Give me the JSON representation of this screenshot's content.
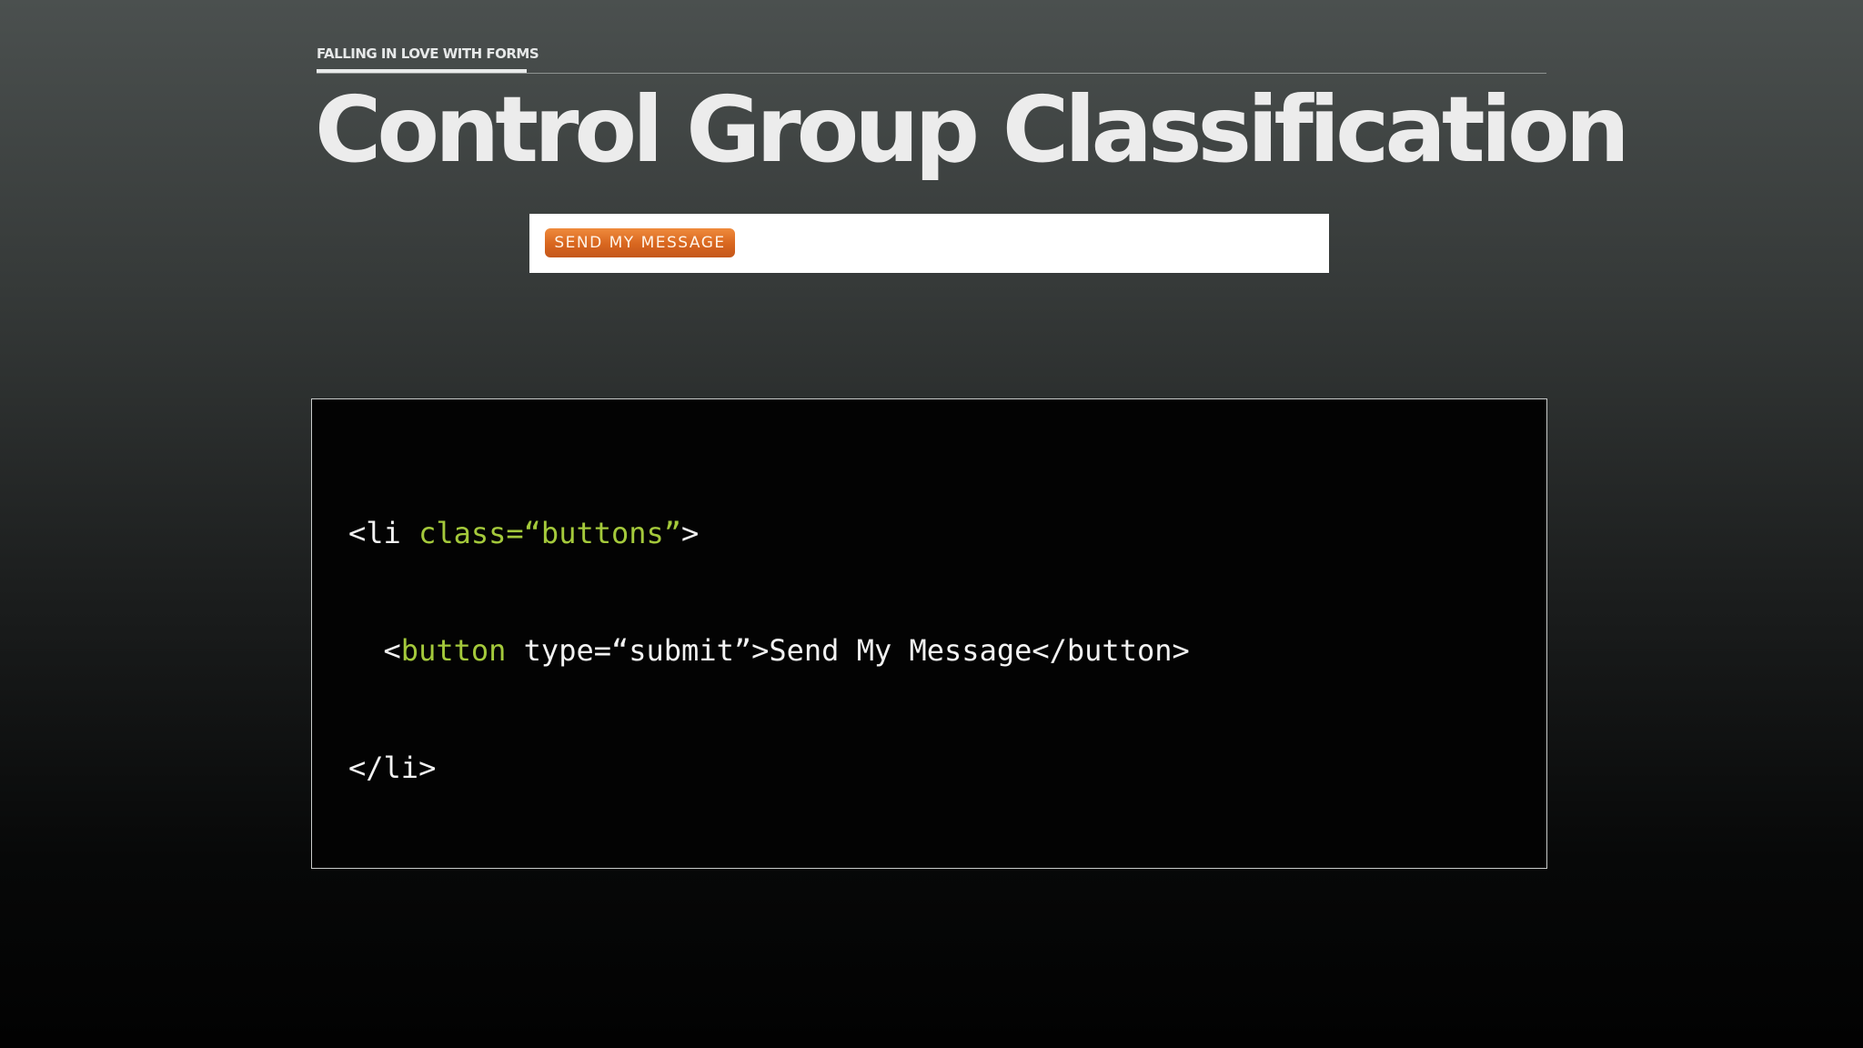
{
  "slide": {
    "eyebrow": "FALLING IN LOVE WITH FORMS",
    "title": "Control Group Classification"
  },
  "preview": {
    "button_label": "SEND MY MESSAGE",
    "button_color": "#dc6a22"
  },
  "code": {
    "lines": [
      {
        "indent": "",
        "tokens": [
          {
            "text": "<li ",
            "color": "default"
          },
          {
            "text": "class=“buttons”",
            "color": "green"
          },
          {
            "text": ">",
            "color": "default"
          }
        ]
      },
      {
        "indent": "  ",
        "tokens": [
          {
            "text": "<",
            "color": "default"
          },
          {
            "text": "button",
            "color": "green"
          },
          {
            "text": " type=“submit”>Send My Message</button>",
            "color": "default"
          }
        ]
      },
      {
        "indent": "",
        "tokens": [
          {
            "text": "</li>",
            "color": "default"
          }
        ]
      }
    ],
    "colors": {
      "default": "#f2f2f2",
      "green": "#a4c93b",
      "background": "#030303"
    }
  }
}
